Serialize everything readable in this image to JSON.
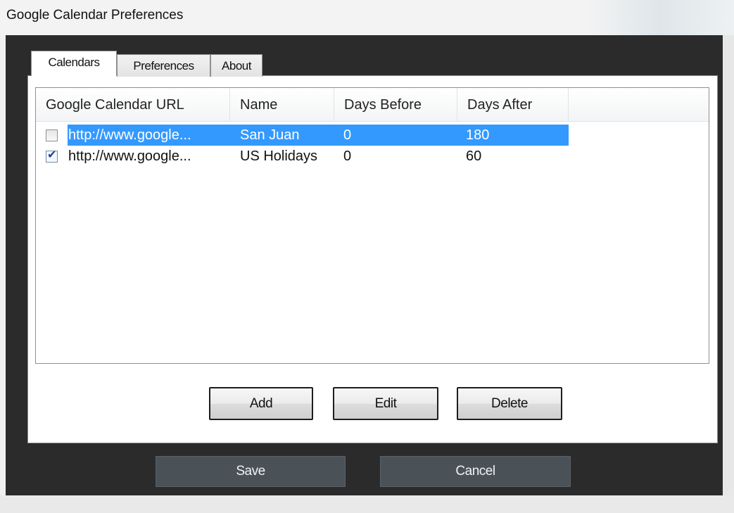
{
  "window": {
    "title": "Google Calendar Preferences"
  },
  "tabs": [
    {
      "label": "Calendars",
      "active": true
    },
    {
      "label": "Preferences",
      "active": false
    },
    {
      "label": "About",
      "active": false
    }
  ],
  "calendar_list": {
    "columns": [
      "Google Calendar URL",
      "Name",
      "Days Before",
      "Days After"
    ],
    "rows": [
      {
        "checked": false,
        "selected": true,
        "url": "http://www.google...",
        "name": "San Juan",
        "days_before": "0",
        "days_after": "180"
      },
      {
        "checked": true,
        "selected": false,
        "url": "http://www.google...",
        "name": "US Holidays",
        "days_before": "0",
        "days_after": "60"
      }
    ]
  },
  "actions": {
    "add_label": "Add",
    "edit_label": "Edit",
    "delete_label": "Delete"
  },
  "footer": {
    "save_label": "Save",
    "cancel_label": "Cancel"
  },
  "colors": {
    "selection": "#3399ff",
    "frame": "#2b2b2b",
    "footer_button": "#4a5258"
  }
}
